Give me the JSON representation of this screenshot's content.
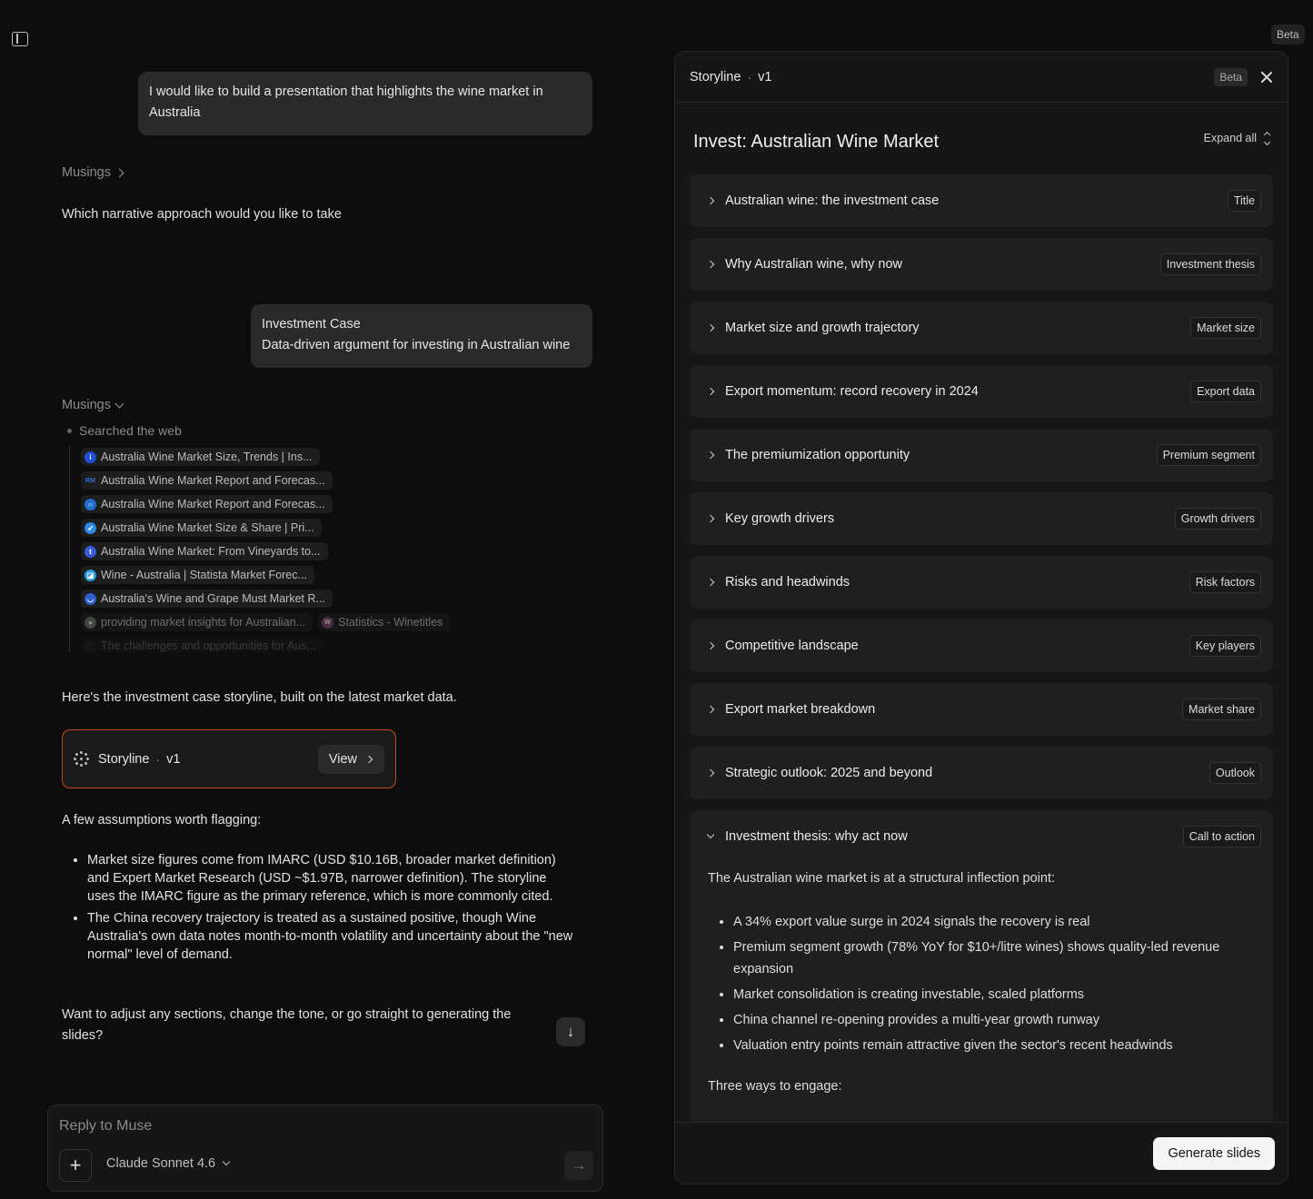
{
  "top_badge": "Beta",
  "chat": {
    "user_message_1": "I would like to build a presentation that highlights the wine market in Australia",
    "musings_label_1": "Musings",
    "question": "Which narrative approach would you like to take",
    "user_choice_title": "Investment Case",
    "user_choice_desc": "Data-driven argument for investing in Australian wine",
    "musings_label_2": "Musings",
    "searched_label": "Searched the web",
    "sources": [
      {
        "title": "Australia Wine Market Size, Trends | Ins...",
        "icon": "i"
      },
      {
        "title": "Australia Wine Market Report and Forecas...",
        "icon": "RM"
      },
      {
        "title": "Australia Wine Market Report and Forecas...",
        "icon": "∩"
      },
      {
        "title": "Australia Wine Market Size & Share | Pri...",
        "icon": "➶"
      },
      {
        "title": "Australia Wine Market: From Vineyards to...",
        "icon": "t"
      },
      {
        "title": "Wine - Australia | Statista Market Forec...",
        "icon": "◪"
      },
      {
        "title": "Australia's Wine and Grape Must Market R...",
        "icon": "◡"
      },
      {
        "title": "providing market insights for Australian...",
        "icon": "●"
      },
      {
        "title": "Statistics - Winetitles",
        "icon": "W"
      },
      {
        "title": "The challenges and opportunities for Aus...",
        "icon": ""
      }
    ],
    "intro_text": "Here's the investment case storyline, built on the latest market data.",
    "card": {
      "name": "Storyline",
      "sep": "·",
      "version": "v1",
      "view": "View"
    },
    "assumptions_heading": "A few assumptions worth flagging:",
    "assumptions": [
      "Market size figures come from IMARC (USD $10.16B, broader market definition) and Expert Market Research (USD ~$1.97B, narrower definition). The storyline uses the IMARC figure as the primary reference, which is more commonly cited.",
      "The China recovery trajectory is treated as a sustained positive, though Wine Australia's own data notes month-to-month volatility and uncertainty about the \"new normal\" level of demand."
    ],
    "closing_question": "Want to adjust any sections, change the tone, or go straight to generating the slides?"
  },
  "composer": {
    "placeholder": "Reply to Muse",
    "model": "Claude Sonnet 4.6"
  },
  "panel": {
    "title": "Storyline",
    "sep": "·",
    "version": "v1",
    "beta": "Beta",
    "doc_title": "Invest: Australian Wine Market",
    "expand_all": "Expand all",
    "sections": [
      {
        "title": "Australian wine: the investment case",
        "tag": "Title"
      },
      {
        "title": "Why Australian wine, why now",
        "tag": "Investment thesis"
      },
      {
        "title": "Market size and growth trajectory",
        "tag": "Market size"
      },
      {
        "title": "Export momentum: record recovery in 2024",
        "tag": "Export data"
      },
      {
        "title": "The premiumization opportunity",
        "tag": "Premium segment"
      },
      {
        "title": "Key growth drivers",
        "tag": "Growth drivers"
      },
      {
        "title": "Risks and headwinds",
        "tag": "Risk factors"
      },
      {
        "title": "Competitive landscape",
        "tag": "Key players"
      },
      {
        "title": "Export market breakdown",
        "tag": "Market share"
      },
      {
        "title": "Strategic outlook: 2025 and beyond",
        "tag": "Outlook"
      }
    ],
    "open_section": {
      "title": "Investment thesis: why act now",
      "tag": "Call to action",
      "intro": "The Australian wine market is at a structural inflection point:",
      "points": [
        "A 34% export value surge in 2024 signals the recovery is real",
        "Premium segment growth (78% YoY for $10+/litre wines) shows quality-led revenue expansion",
        "Market consolidation is creating investable, scaled platforms",
        "China channel re-opening provides a multi-year growth runway",
        "Valuation entry points remain attractive given the sector's recent headwinds"
      ],
      "engage": "Three ways to engage:"
    },
    "generate_button": "Generate slides"
  }
}
